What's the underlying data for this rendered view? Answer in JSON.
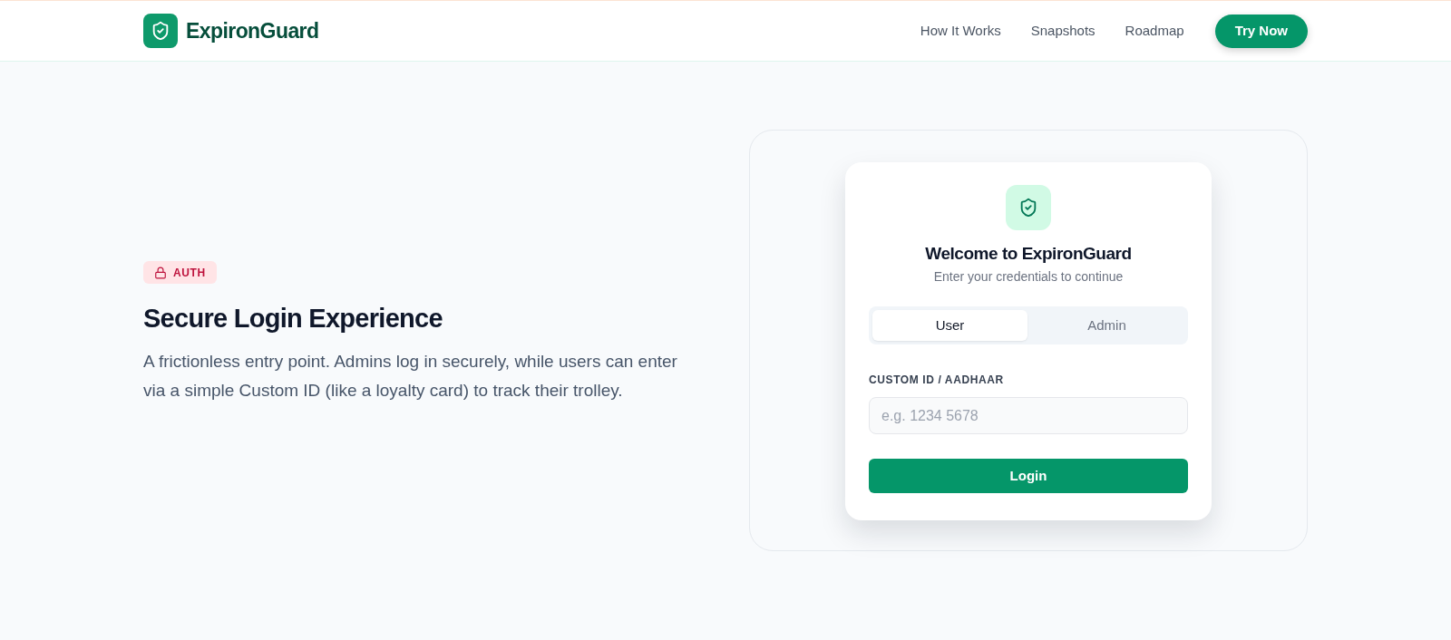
{
  "header": {
    "brand": "ExpironGuard",
    "nav_links": [
      "How It Works",
      "Snapshots",
      "Roadmap"
    ],
    "cta": "Try Now"
  },
  "feature": {
    "badge": "AUTH",
    "title": "Secure Login Experience",
    "description": "A frictionless entry point. Admins log in securely, while users can enter via a simple Custom ID (like a loyalty card) to track their trolley."
  },
  "login_card": {
    "title": "Welcome to ExpironGuard",
    "subtitle": "Enter your credentials to continue",
    "tabs": [
      {
        "label": "User",
        "selected": true
      },
      {
        "label": "Admin",
        "selected": false
      }
    ],
    "field": {
      "label": "CUSTOM ID / AADHAAR",
      "placeholder": "e.g. 1234 5678"
    },
    "submit": "Login"
  }
}
